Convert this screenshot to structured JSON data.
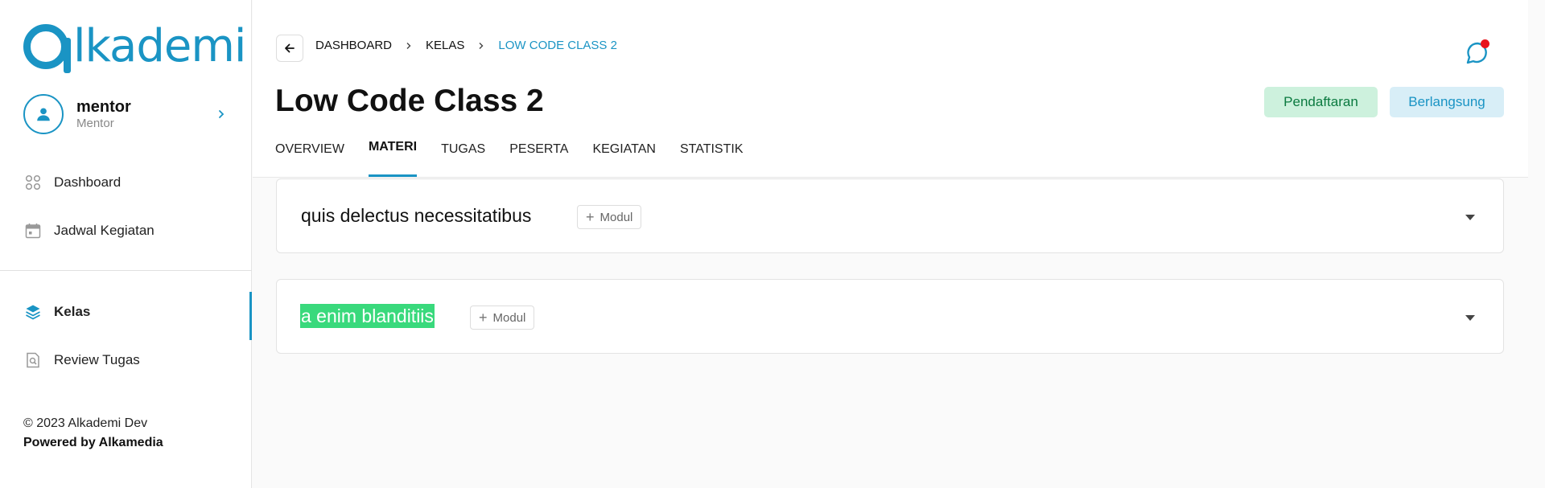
{
  "app": {
    "logo_text": "lkademi",
    "logo_full": "Alkademi"
  },
  "user": {
    "name": "mentor",
    "role": "Mentor"
  },
  "sidebar": {
    "items": [
      {
        "label": "Dashboard",
        "icon": "dashboard-icon"
      },
      {
        "label": "Jadwal Kegiatan",
        "icon": "calendar-icon"
      },
      {
        "label": "Kelas",
        "icon": "layers-icon",
        "active": true
      },
      {
        "label": "Review Tugas",
        "icon": "document-search-icon"
      }
    ]
  },
  "footer": {
    "copyright": "© 2023 Alkademi Dev",
    "powered": "Powered by Alkamedia"
  },
  "breadcrumb": [
    "DASHBOARD",
    "KELAS",
    "LOW CODE CLASS 2"
  ],
  "page": {
    "title": "Low Code Class 2",
    "badges": [
      "Pendaftaran",
      "Berlangsung"
    ]
  },
  "tabs": [
    {
      "label": "OVERVIEW"
    },
    {
      "label": "MATERI",
      "active": true
    },
    {
      "label": "TUGAS"
    },
    {
      "label": "PESERTA"
    },
    {
      "label": "KEGIATAN"
    },
    {
      "label": "STATISTIK"
    }
  ],
  "sections": [
    {
      "title": "quis delectus necessitatibus",
      "button": "Modul"
    },
    {
      "title": "a enim blanditiis",
      "button": "Modul",
      "highlighted": true
    }
  ],
  "colors": {
    "accent": "#1a94c4",
    "success_bg": "#cdf1dd",
    "success_text": "#0b7a40",
    "info_bg": "#d8eef7",
    "highlight": "#39d97c",
    "notification": "#e8131b"
  }
}
